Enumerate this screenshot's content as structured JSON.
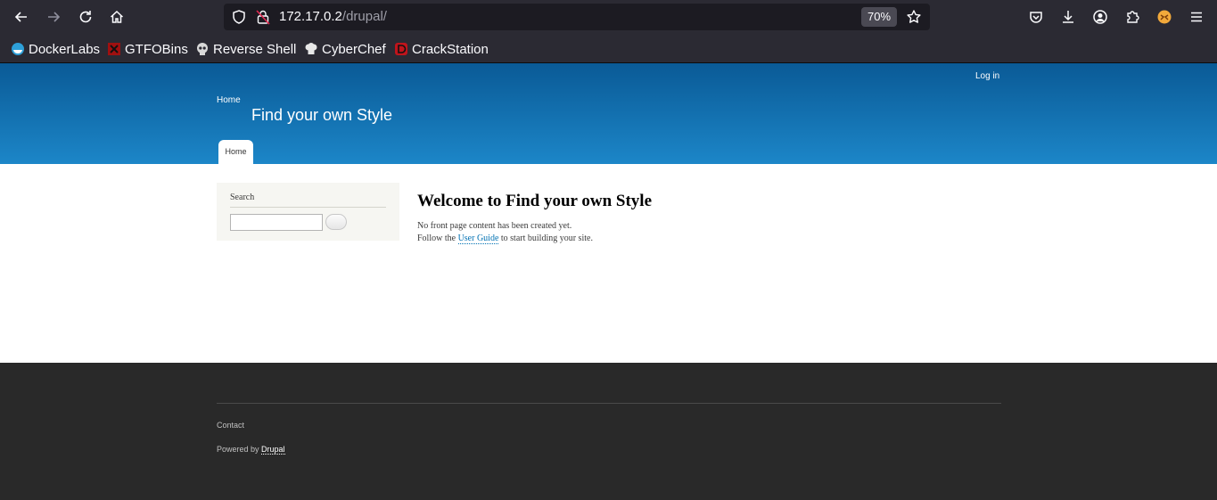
{
  "browser": {
    "url_host": "172.17.0.2",
    "url_path": "/drupal/",
    "zoom": "70%",
    "bookmarks": [
      {
        "label": "DockerLabs",
        "icon": "dockerlabs-icon"
      },
      {
        "label": "GTFOBins",
        "icon": "gtfobins-icon"
      },
      {
        "label": "Reverse Shell",
        "icon": "skull-icon"
      },
      {
        "label": "CyberChef",
        "icon": "chef-hat-icon"
      },
      {
        "label": "CrackStation",
        "icon": "crackstation-icon"
      }
    ]
  },
  "header": {
    "login_label": "Log in",
    "home_label": "Home",
    "site_name": "Find your own Style",
    "tab_home": "Home"
  },
  "sidebar": {
    "search_title": "Search",
    "search_value": ""
  },
  "main": {
    "title": "Welcome to Find your own Style",
    "line1": "No front page content has been created yet.",
    "line2_prefix": "Follow the ",
    "line2_link": "User Guide",
    "line2_suffix": " to start building your site."
  },
  "footer": {
    "contact_label": "Contact",
    "powered_prefix": "Powered by ",
    "powered_link": "Drupal"
  },
  "colors": {
    "header_top": "#0a5a96",
    "header_bottom": "#1c86c8",
    "footer_bg": "#292929",
    "link": "#0071b3"
  }
}
